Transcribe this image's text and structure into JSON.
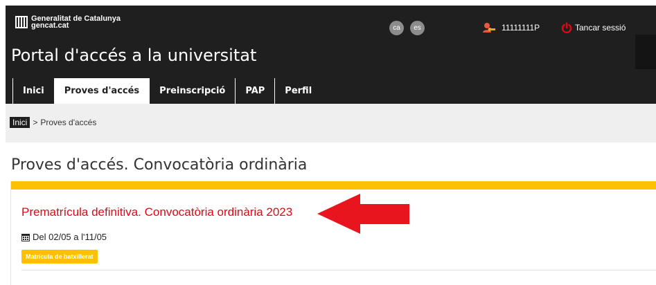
{
  "header": {
    "brand_line1": "Generalitat de Catalunya",
    "brand_line2": "gencat.cat",
    "languages": [
      "ca",
      "es"
    ],
    "user_id": "11111111P",
    "logout_label": "Tancar sessió",
    "portal_title": "Portal d'accés a la universitat"
  },
  "nav": {
    "items": [
      {
        "label": "Inici",
        "active": false
      },
      {
        "label": "Proves d'accés",
        "active": true
      },
      {
        "label": "Preinscripció",
        "active": false
      },
      {
        "label": "PAP",
        "active": false
      },
      {
        "label": "Perfil",
        "active": false
      }
    ]
  },
  "breadcrumb": {
    "home": "Inici",
    "separator": ">",
    "current": "Proves d'accés"
  },
  "page": {
    "title": "Proves d'accés. Convocatòria ordinària"
  },
  "card": {
    "title": "Prematrícula definitiva. Convocatòria ordinària 2023",
    "dates": "Del 02/05 a l'11/05",
    "badge": "Matrícula de batxillerat"
  },
  "colors": {
    "header_bg": "#1f1f1f",
    "accent_yellow": "#fdc103",
    "link_red": "#e30613",
    "arrow_red": "#e8141e"
  },
  "icons": [
    "gencat-logo-icon",
    "user-key-icon",
    "power-icon",
    "calendar-icon",
    "arrow-left-icon"
  ]
}
